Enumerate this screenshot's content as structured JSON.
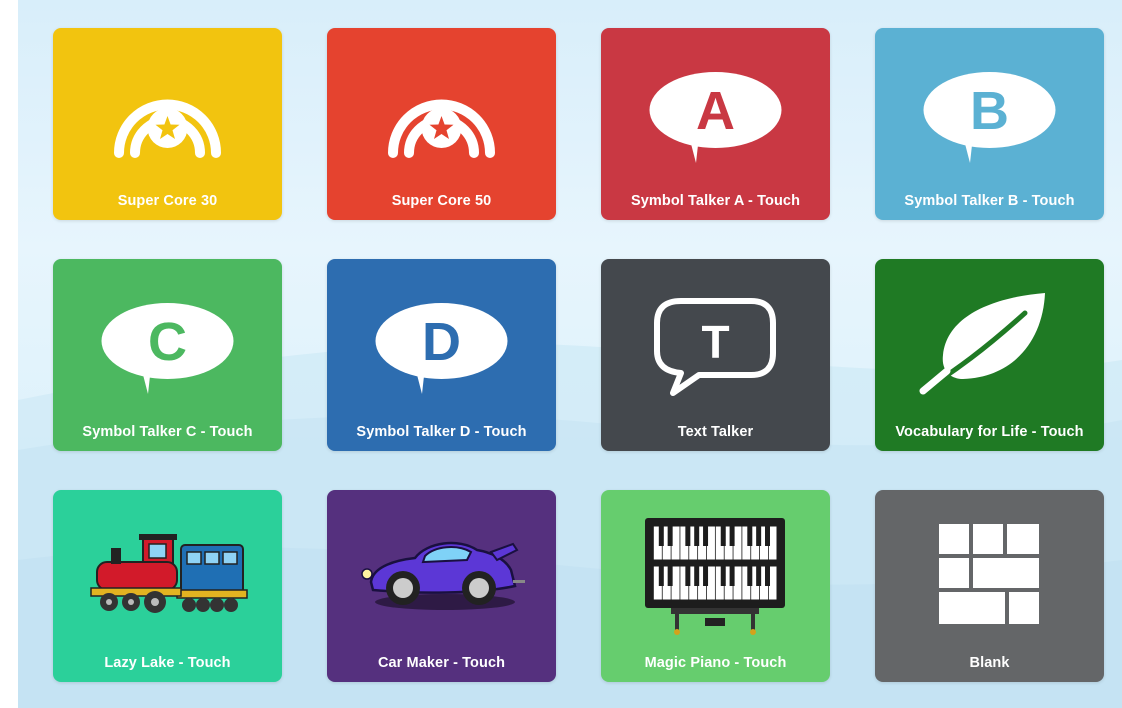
{
  "tiles": [
    {
      "label": "Super Core 30",
      "color": "#f2c40f",
      "icon": "super-core-rainbow-icon"
    },
    {
      "label": "Super Core 50",
      "color": "#e5432f",
      "icon": "super-core-rainbow-icon"
    },
    {
      "label": "Symbol Talker A - Touch",
      "color": "#c93843",
      "icon": "speech-bubble-letter-icon",
      "letter": "A"
    },
    {
      "label": "Symbol Talker B - Touch",
      "color": "#5bb1d3",
      "icon": "speech-bubble-letter-icon",
      "letter": "B"
    },
    {
      "label": "Symbol Talker C - Touch",
      "color": "#4cb860",
      "icon": "speech-bubble-letter-icon",
      "letter": "C"
    },
    {
      "label": "Symbol Talker D - Touch",
      "color": "#2d6db0",
      "icon": "speech-bubble-letter-icon",
      "letter": "D"
    },
    {
      "label": "Text Talker",
      "color": "#44484d",
      "icon": "speech-bubble-outline-icon",
      "letter": "T"
    },
    {
      "label": "Vocabulary for Life - Touch",
      "color": "#1f7a24",
      "icon": "leaf-icon"
    },
    {
      "label": "Lazy Lake - Touch",
      "color": "#2bd09a",
      "icon": "train-icon"
    },
    {
      "label": "Car Maker - Touch",
      "color": "#55307e",
      "icon": "race-car-icon"
    },
    {
      "label": "Magic Piano - Touch",
      "color": "#66cd6e",
      "icon": "piano-icon"
    },
    {
      "label": "Blank",
      "color": "#646668",
      "icon": "blank-grid-icon"
    }
  ]
}
